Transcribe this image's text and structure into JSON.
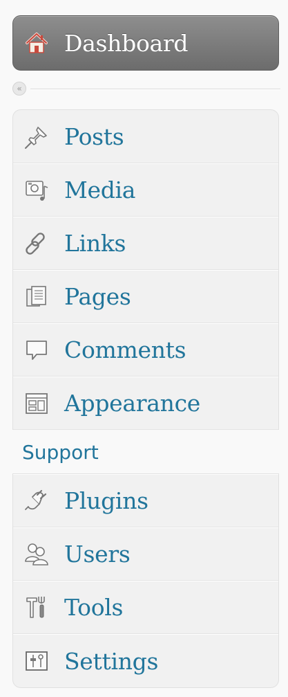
{
  "dashboard": {
    "label": "Dashboard",
    "icon": "home-icon"
  },
  "collapse": {
    "glyph": "«",
    "icon": "collapse-menu-icon"
  },
  "menu_group1": [
    {
      "label": "Posts",
      "icon": "pushpin-icon"
    },
    {
      "label": "Media",
      "icon": "media-icon"
    },
    {
      "label": "Links",
      "icon": "link-icon"
    },
    {
      "label": "Pages",
      "icon": "pages-icon"
    },
    {
      "label": "Comments",
      "icon": "comment-bubble-icon"
    },
    {
      "label": "Appearance",
      "icon": "appearance-icon"
    }
  ],
  "support": {
    "label": "Support"
  },
  "menu_group2": [
    {
      "label": "Plugins",
      "icon": "plug-icon"
    },
    {
      "label": "Users",
      "icon": "users-icon"
    },
    {
      "label": "Tools",
      "icon": "tools-icon"
    },
    {
      "label": "Settings",
      "icon": "settings-icon"
    }
  ],
  "colors": {
    "link": "#21759b",
    "dashboard_bg": "#7a7a7a",
    "menu_bg": "#f1f1f1",
    "home_icon": "#d9685a"
  }
}
